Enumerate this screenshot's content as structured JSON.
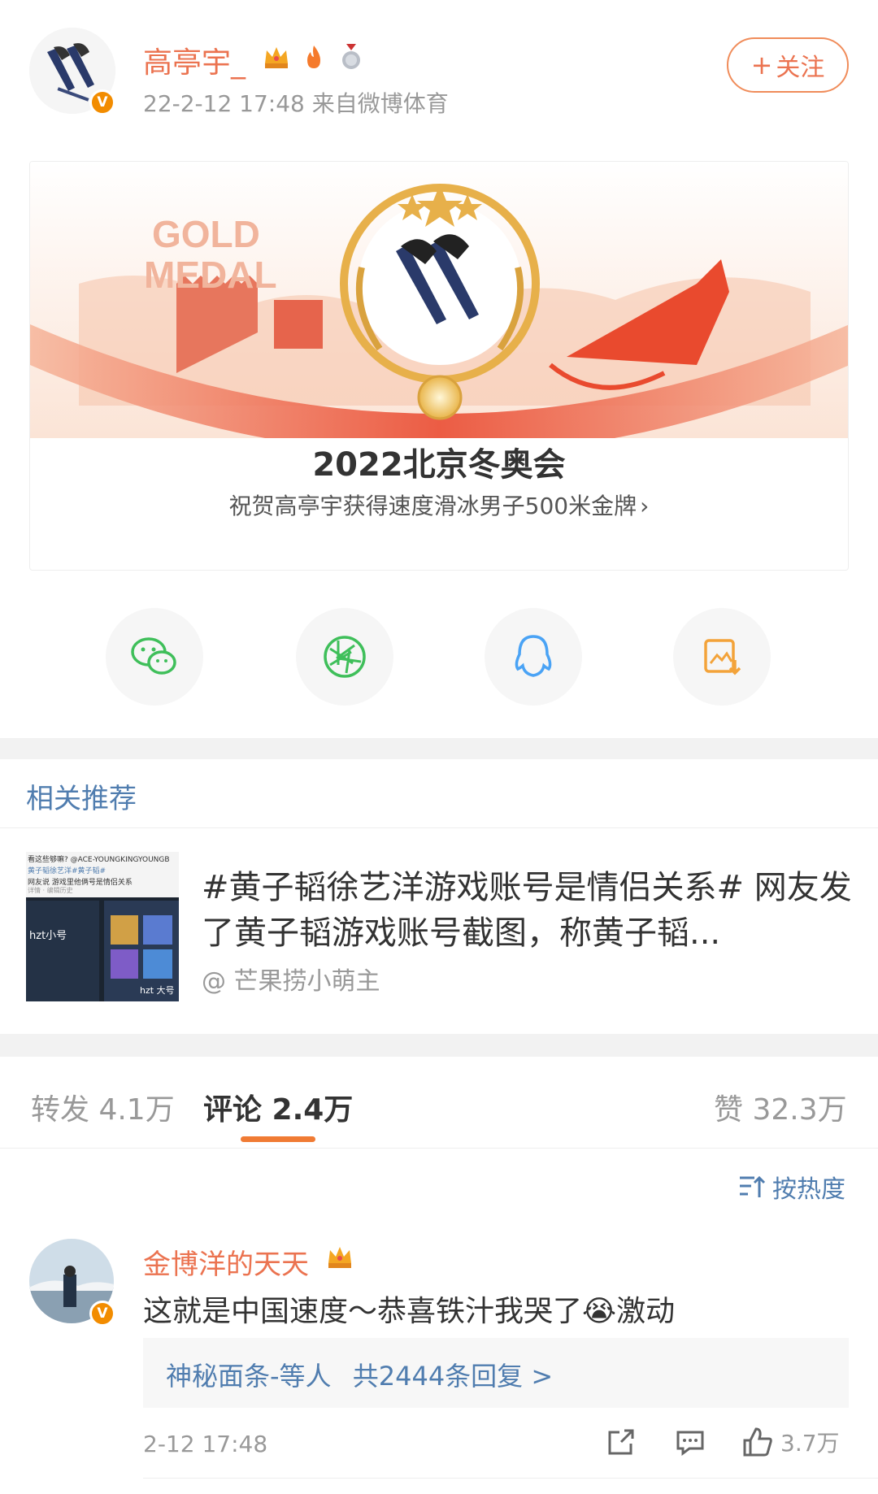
{
  "post": {
    "username": "高亭宇_",
    "meta": "22-2-12 17:48  来自微博体育",
    "follow_label": "关注"
  },
  "card": {
    "banner_text_1": "GOLD",
    "banner_text_2": "MEDAL",
    "title": "2022北京冬奥会",
    "subtitle": "祝贺高亭宇获得速度滑冰男子500米金牌"
  },
  "share": [
    "wechat-icon",
    "moments-icon",
    "qq-icon",
    "save-image-icon"
  ],
  "related": {
    "section_title": "相关推荐",
    "text": "#黄子韬徐艺洋游戏账号是情侣关系# 网友发了黄子韬游戏账号截图，称黄子韬...",
    "author": "@ 芒果捞小萌主",
    "thumb_top": "看这些够嘛? @ACE-YOUNGKINGYOUNGB",
    "thumb_line2": "黄子韬徐艺洋#黄子韬#",
    "thumb_line3": "网友说 游戏里他俩号是情侣关系",
    "thumb_line4": "详情 · 编辑历史",
    "thumb_label_1": "hzt小号",
    "thumb_label_2": "hzt 大号"
  },
  "tabs": {
    "repost": "转发 4.1万",
    "comment": "评论 2.4万",
    "like": "赞 32.3万"
  },
  "sort_label": "按热度",
  "comment": {
    "name": "金博洋的天天",
    "text": "这就是中国速度～恭喜铁汁我哭了😭激动",
    "reply_summary": "神秘面条-等人",
    "reply_count": "共2444条回复 >",
    "time": "2-12 17:48",
    "likes": "3.7万"
  },
  "colors": {
    "accent": "#eb7350",
    "link": "#507daf",
    "tab_underline": "#f07b34"
  }
}
